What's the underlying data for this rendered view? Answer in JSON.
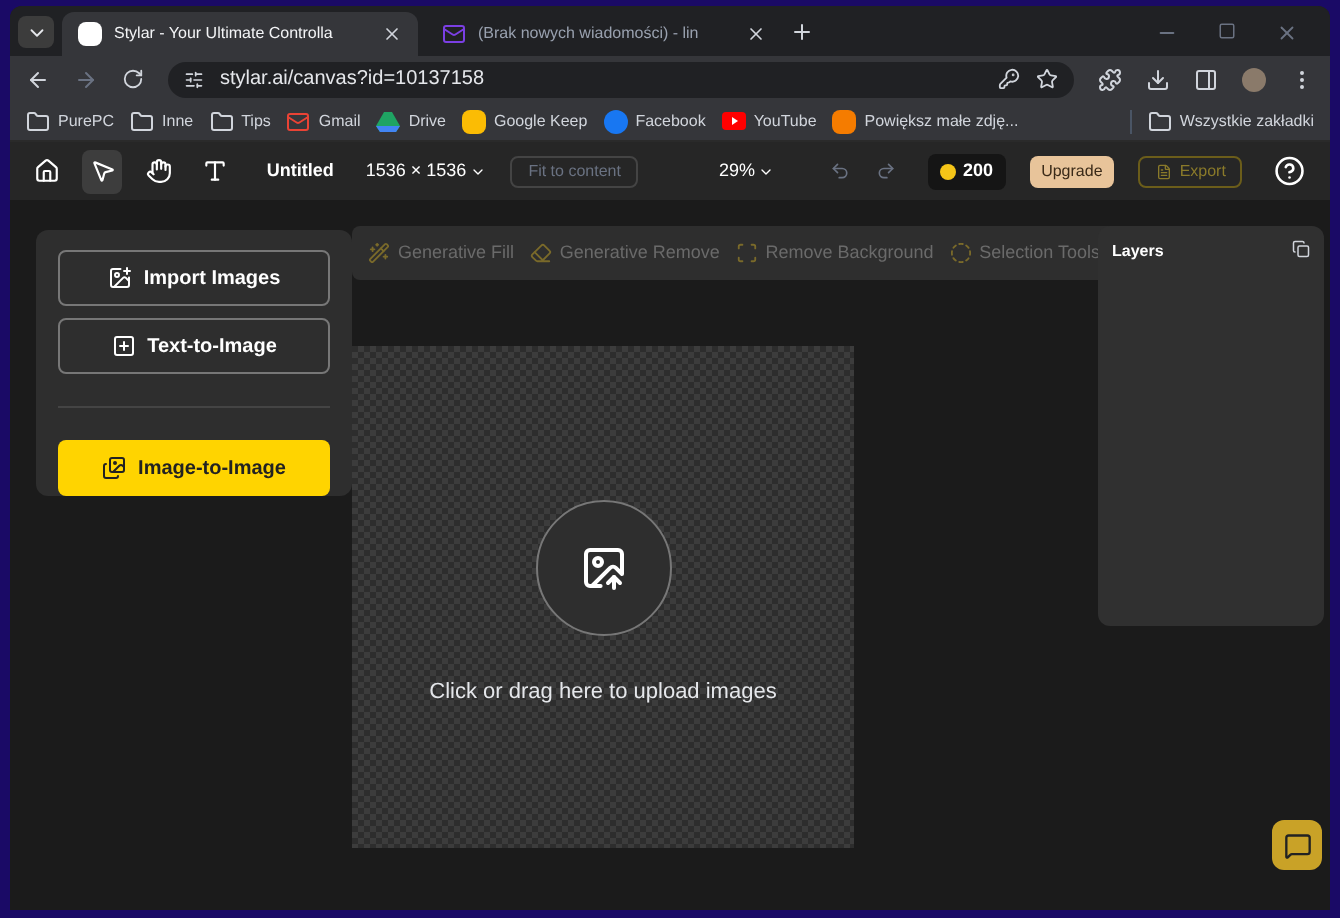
{
  "browser": {
    "tabs": [
      {
        "title": "Stylar - Your Ultimate Controlla",
        "kind": "stylar",
        "selected": true
      },
      {
        "title": "(Brak nowych wiadomości) - lin",
        "kind": "mail",
        "selected": false
      }
    ],
    "address": "stylar.ai/canvas?id=10137158",
    "bookmarks": [
      {
        "label": "PurePC",
        "kind": "folder"
      },
      {
        "label": "Inne",
        "kind": "folder"
      },
      {
        "label": "Tips",
        "kind": "folder"
      },
      {
        "label": "Gmail",
        "kind": "gmail"
      },
      {
        "label": "Drive",
        "kind": "drive"
      },
      {
        "label": "Google Keep",
        "kind": "keep"
      },
      {
        "label": "Facebook",
        "kind": "facebook"
      },
      {
        "label": "YouTube",
        "kind": "youtube"
      },
      {
        "label": "Powiększ małe zdję...",
        "kind": "site"
      }
    ],
    "bookmarks_all": "Wszystkie zakładki"
  },
  "toolbar": {
    "tools": [
      {
        "kind": "home",
        "selected": false
      },
      {
        "kind": "select",
        "selected": true
      },
      {
        "kind": "hand",
        "selected": false
      },
      {
        "kind": "text",
        "selected": false
      }
    ],
    "title": "Untitled",
    "size": "1536 × 1536",
    "fit": "Fit to content",
    "zoom": "29%",
    "credits": "200",
    "upgrade": "Upgrade",
    "export": "Export"
  },
  "edit_tools": [
    {
      "label": "Generative Fill",
      "kind": "fill",
      "disabled": true
    },
    {
      "label": "Generative Remove",
      "kind": "remove",
      "disabled": true
    },
    {
      "label": "Remove Background",
      "kind": "background",
      "disabled": true
    },
    {
      "label": "Selection Tools",
      "kind": "selection",
      "disabled": true
    }
  ],
  "actions": [
    {
      "label": "Import Images",
      "kind": "import",
      "primary": false
    },
    {
      "label": "Text-to-Image",
      "kind": "text",
      "primary": false
    },
    {
      "label": "Image-to-Image",
      "kind": "image",
      "primary": true
    }
  ],
  "upload_text": "Click or drag here to upload images",
  "layers": {
    "title": "Layers"
  }
}
